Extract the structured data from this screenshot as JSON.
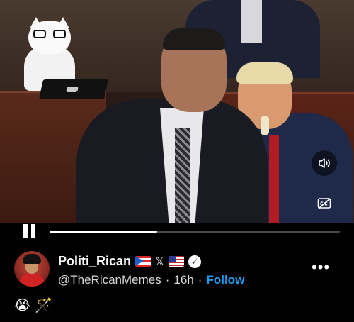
{
  "video": {
    "progress": 0.37,
    "mute_icon": "speaker-icon",
    "captions_icon": "captions-icon",
    "pause_icon": "pause-icon"
  },
  "author": {
    "display_name": "Politi_Rican",
    "badges": [
      "puerto-rico-flag",
      "x",
      "us-flag"
    ],
    "x_glyph": "𝕏",
    "verified_glyph": "✓",
    "handle": "@TheRicanMemes",
    "separator": "·",
    "time": "16h",
    "follow_label": "Follow",
    "more_label": "•••"
  },
  "post": {
    "emoji_1": "😭",
    "emoji_2": "🪄"
  },
  "colors": {
    "background": "#000000",
    "follow_blue": "#1d9bf0",
    "text_secondary": "#d9d9d9"
  }
}
